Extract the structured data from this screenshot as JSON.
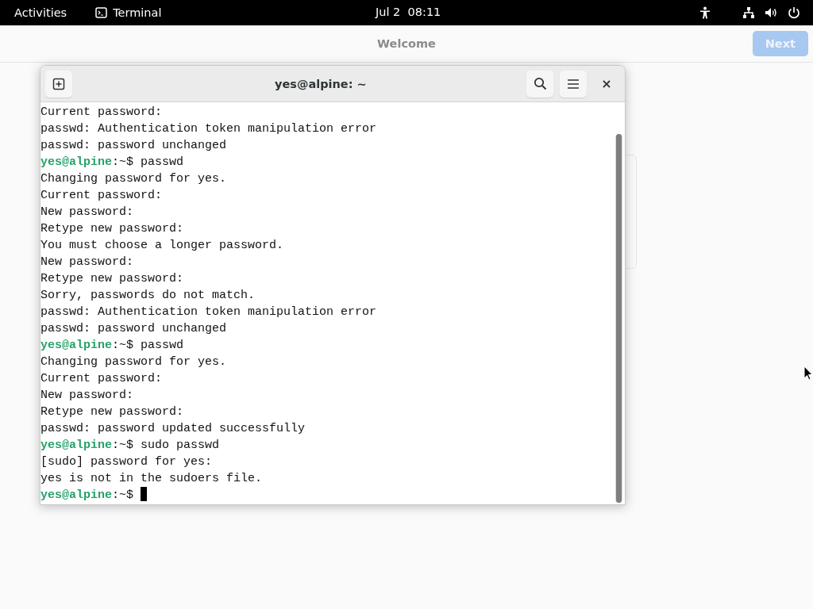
{
  "top_bar": {
    "activities": "Activities",
    "app": "Terminal",
    "clock": "Jul 2  08:11"
  },
  "welcome": {
    "title": "Welcome",
    "next_button": {
      "label": "Next",
      "disabled": true
    }
  },
  "terminal": {
    "title": "yes@alpine: ~",
    "lines": [
      {
        "kind": "output",
        "text": "Current password:"
      },
      {
        "kind": "output",
        "text": "passwd: Authentication token manipulation error"
      },
      {
        "kind": "output",
        "text": "passwd: password unchanged"
      },
      {
        "kind": "prompt",
        "prompt": "yes@alpine",
        "rest": ":~$ passwd"
      },
      {
        "kind": "output",
        "text": "Changing password for yes."
      },
      {
        "kind": "output",
        "text": "Current password:"
      },
      {
        "kind": "output",
        "text": "New password:"
      },
      {
        "kind": "output",
        "text": "Retype new password:"
      },
      {
        "kind": "output",
        "text": "You must choose a longer password."
      },
      {
        "kind": "output",
        "text": "New password:"
      },
      {
        "kind": "output",
        "text": "Retype new password:"
      },
      {
        "kind": "output",
        "text": "Sorry, passwords do not match."
      },
      {
        "kind": "output",
        "text": "passwd: Authentication token manipulation error"
      },
      {
        "kind": "output",
        "text": "passwd: password unchanged"
      },
      {
        "kind": "prompt",
        "prompt": "yes@alpine",
        "rest": ":~$ passwd"
      },
      {
        "kind": "output",
        "text": "Changing password for yes."
      },
      {
        "kind": "output",
        "text": "Current password:"
      },
      {
        "kind": "output",
        "text": "New password:"
      },
      {
        "kind": "output",
        "text": "Retype new password:"
      },
      {
        "kind": "output",
        "text": "passwd: password updated successfully"
      },
      {
        "kind": "prompt",
        "prompt": "yes@alpine",
        "rest": ":~$ sudo passwd"
      },
      {
        "kind": "output",
        "text": "[sudo] password for yes:"
      },
      {
        "kind": "output",
        "text": "yes is not in the sudoers file."
      },
      {
        "kind": "prompt",
        "prompt": "yes@alpine",
        "rest": ":~$ ",
        "cursor": true
      }
    ]
  }
}
